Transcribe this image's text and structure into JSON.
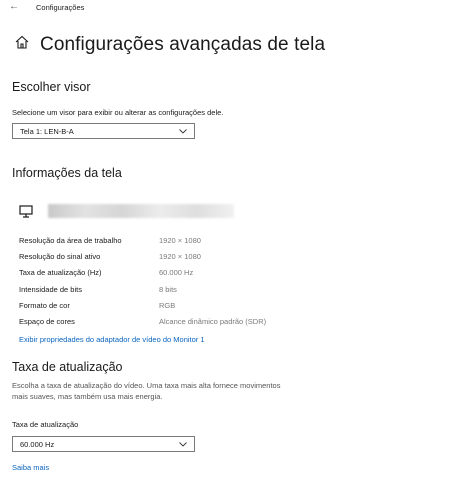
{
  "window": {
    "app_title": "Configurações"
  },
  "header": {
    "title": "Configurações avançadas de tela"
  },
  "choose_display": {
    "heading": "Escolher visor",
    "description": "Selecione um visor para exibir ou alterar as configurações dele.",
    "selected": "Tela 1: LEN-B-A"
  },
  "display_info": {
    "heading": "Informações da tela",
    "rows": [
      {
        "label": "Resolução da área de trabalho",
        "value": "1920 × 1080"
      },
      {
        "label": "Resolução do sinal ativo",
        "value": "1920 × 1080"
      },
      {
        "label": "Taxa de atualização (Hz)",
        "value": "60.000 Hz"
      },
      {
        "label": "Intensidade de bits",
        "value": "8 bits"
      },
      {
        "label": "Formato de cor",
        "value": "RGB"
      },
      {
        "label": "Espaço de cores",
        "value": "Alcance dinâmico padrão (SDR)"
      }
    ],
    "adapter_link": "Exibir propriedades do adaptador de vídeo do Monitor 1"
  },
  "refresh_rate": {
    "heading": "Taxa de atualização",
    "description": "Escolha a taxa de atualização do vídeo. Uma taxa mais alta fornece movimentos mais suaves, mas também usa mais energia.",
    "field_label": "Taxa de atualização",
    "selected": "60.000 Hz",
    "learn_more": "Saiba mais"
  },
  "colors": {
    "link": "#0a65c0",
    "muted_value": "#7a7a7a"
  },
  "icons": [
    "back-arrow-icon",
    "home-icon",
    "monitor-icon",
    "chevron-down-icon"
  ]
}
